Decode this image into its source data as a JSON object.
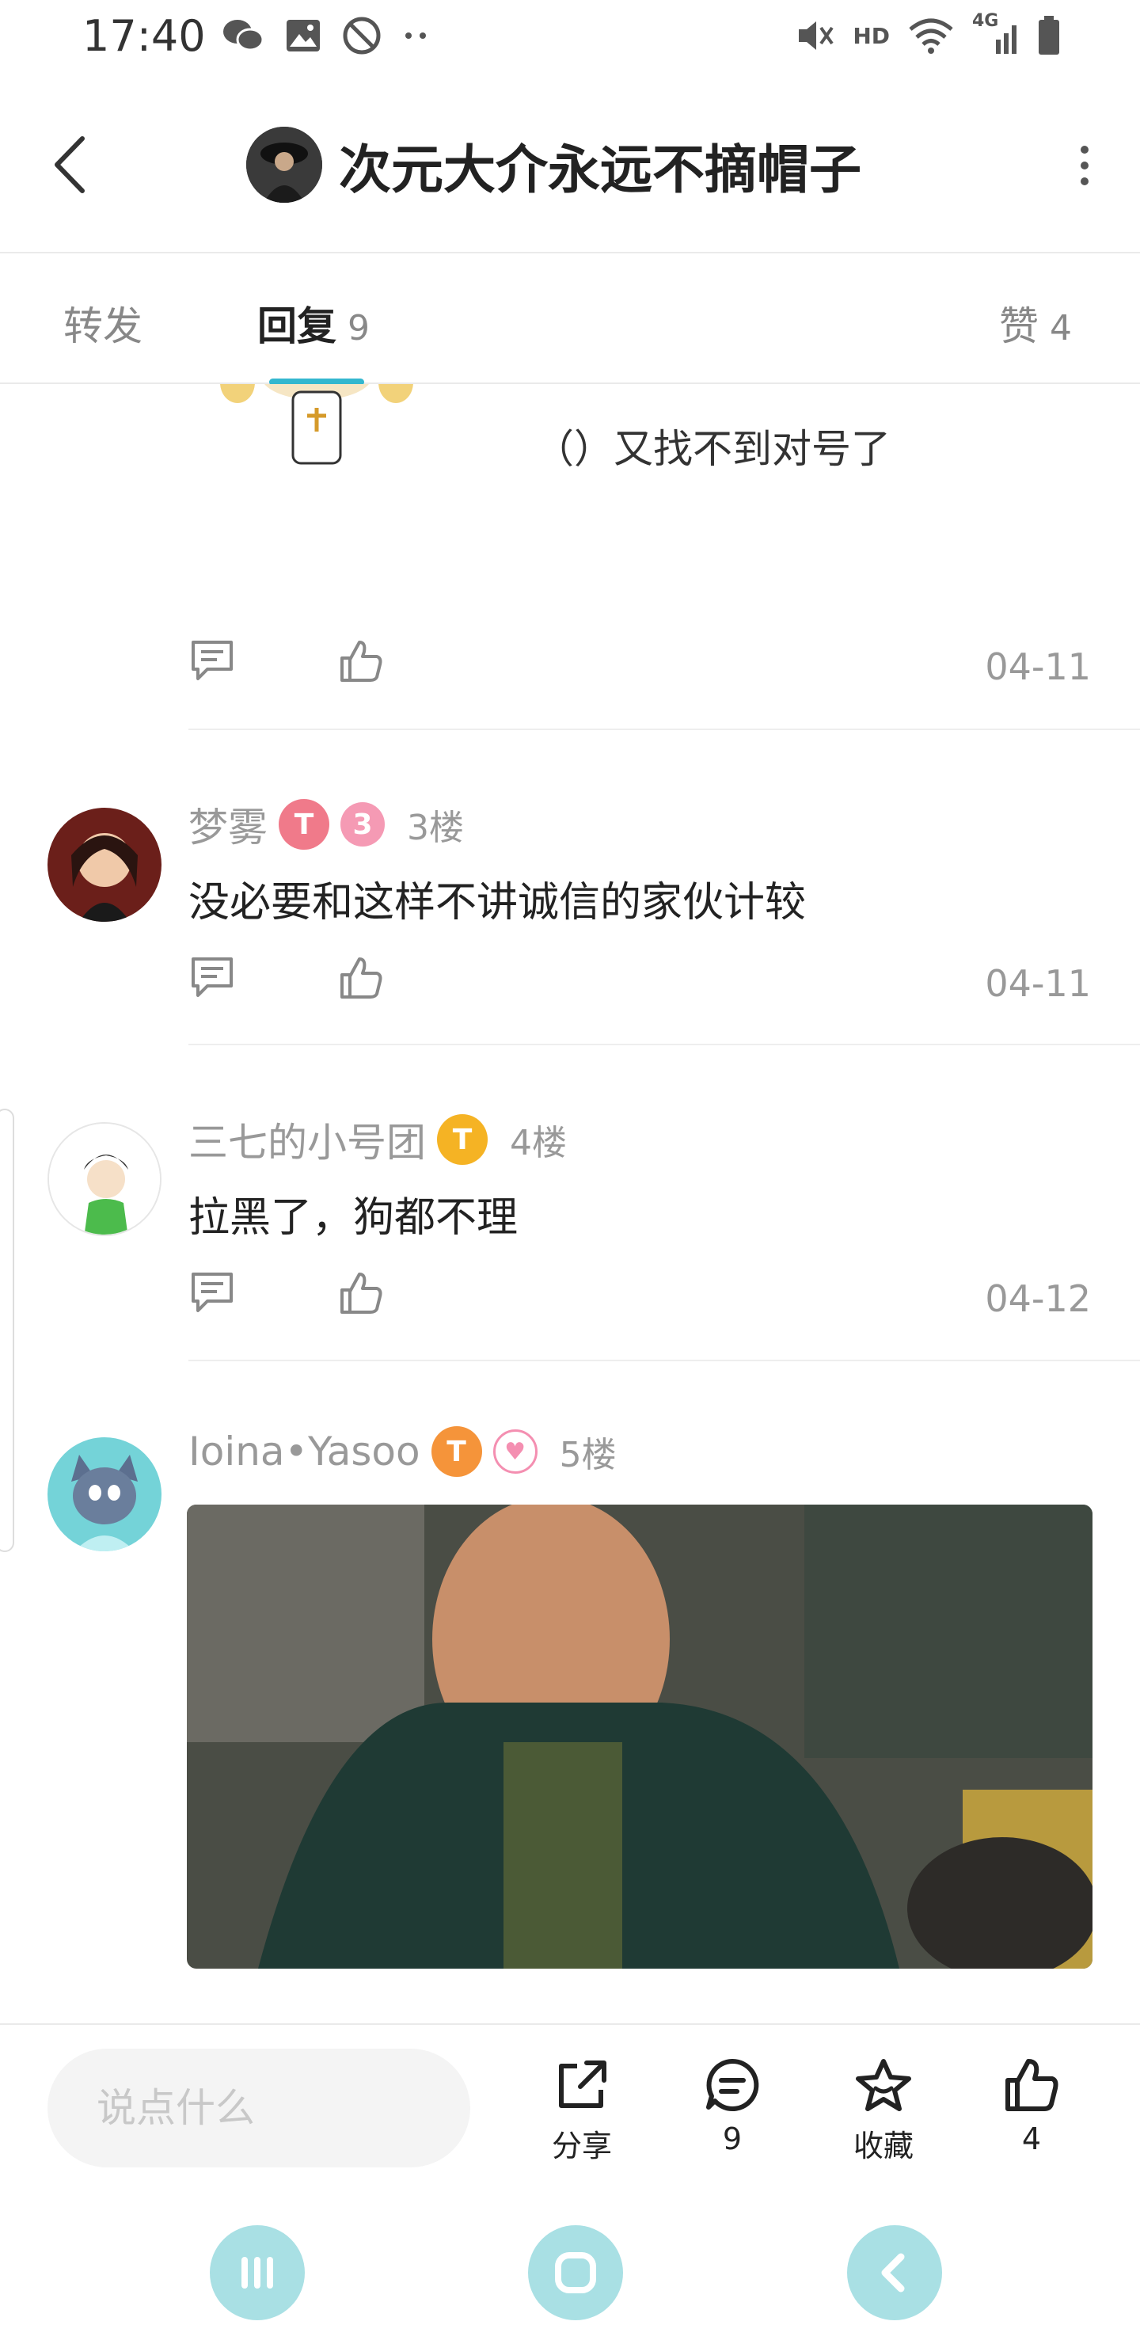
{
  "status_bar": {
    "time": "17:40",
    "network_label": "HD",
    "cell_label": "4G"
  },
  "header": {
    "title": "次元大介永远不摘帽子"
  },
  "tabs": [
    {
      "label": "转发",
      "count": ""
    },
    {
      "label": "回复",
      "count": "9"
    },
    {
      "label": "赞",
      "count": "4"
    }
  ],
  "first_reply": {
    "text": "（）又找不到对号了",
    "date": "04-11"
  },
  "comments": [
    {
      "name": "梦雾",
      "floor": "3楼",
      "text": "没必要和这样不讲诚信的家伙计较",
      "date": "04-11"
    },
    {
      "name": "三七的小号团",
      "floor": "4楼",
      "text": "拉黑了，狗都不理",
      "date": "04-12"
    },
    {
      "name": "Ioina•Yasoo",
      "floor": "5楼"
    }
  ],
  "bottom_bar": {
    "input_placeholder": "说点什么",
    "share_label": "分享",
    "comment_count": "9",
    "favorite_label": "收藏",
    "like_count": "4"
  },
  "colors": {
    "accent": "#33b7cf",
    "nav_button": "#a9e0e4"
  }
}
